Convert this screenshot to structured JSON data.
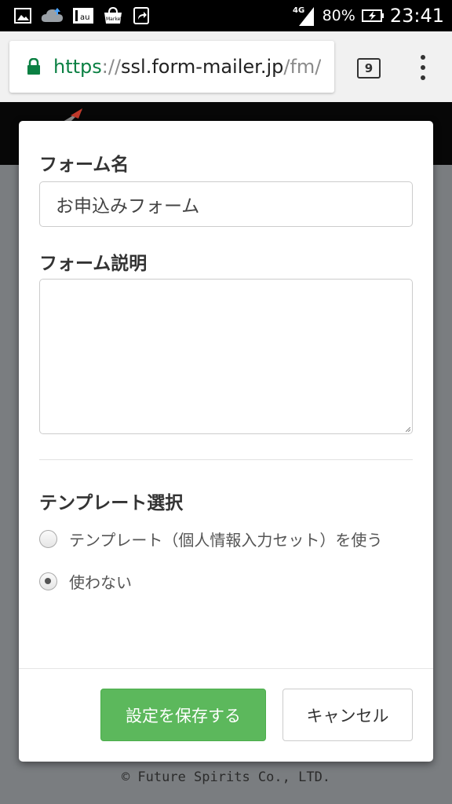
{
  "status_bar": {
    "network": "4G",
    "battery": "80%",
    "time": "23:41",
    "left_icons": [
      "gallery-icon",
      "cloud-upload-icon",
      "au-icon",
      "market-icon",
      "share-icon"
    ]
  },
  "browser": {
    "url_scheme": "https",
    "url_sep": "://",
    "url_host": "ssl.form-mailer.jp",
    "url_path": "/fm/",
    "tab_count": "9"
  },
  "modal": {
    "form_name_label": "フォーム名",
    "form_name_value": "お申込みフォーム",
    "form_desc_label": "フォーム説明",
    "form_desc_value": "",
    "template_label": "テンプレート選択",
    "options": [
      {
        "label": "テンプレート（個人情報入力セット）を使う",
        "checked": false
      },
      {
        "label": "使わない",
        "checked": true
      }
    ],
    "save_button": "設定を保存する",
    "cancel_button": "キャンセル"
  },
  "footer": {
    "copyright": "© Future Spirits Co., LTD."
  },
  "colors": {
    "accent_green": "#5cb85c",
    "url_scheme_green": "#0b8043"
  }
}
